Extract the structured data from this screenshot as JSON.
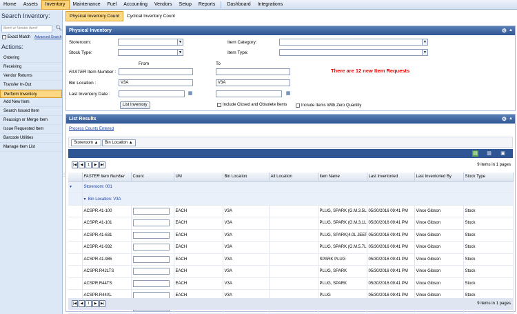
{
  "menu": [
    "Home",
    "Assets",
    "Inventory",
    "Maintenance",
    "Fuel",
    "Accounting",
    "Vendors",
    "Setup",
    "Reports",
    "Dashboard",
    "Integrations"
  ],
  "menu_active": "Inventory",
  "submenu": [
    "Physical Inventory Count",
    "Cyclical Inventory Count"
  ],
  "sidebar": {
    "search_title": "Search Inventory:",
    "search_placeholder": "Item# or Vendor Item#",
    "exact_match": "Exact Match",
    "advanced_search": "Advanced Search",
    "actions_title": "Actions:",
    "actions": [
      "Ordering",
      "Receiving",
      "Vendor Returns",
      "Transfer In-Out",
      "Perform Inventory",
      "Add New Item",
      "Search Issued Item",
      "Reassign or Merge Item",
      "Issue Requested Item",
      "Barcode Utilities",
      "Manage Item List"
    ],
    "active_action": "Perform Inventory"
  },
  "physical_inventory": {
    "title": "Physical Inventory",
    "storeroom_label": "Storeroom:",
    "stock_type_label": "Stock Type:",
    "item_category_label": "Item Category:",
    "item_type_label": "Item Type:",
    "from_label": "From",
    "to_label": "To",
    "item_number_label_prefix": "FASTER",
    "item_number_label_suffix": "Item Number :",
    "bin_location_label": "Bin Location :",
    "bin_from": "V3A",
    "bin_to": "V3A",
    "last_inventory_date_label": "Last Inventory Date :",
    "list_button": "List Inventory",
    "include_closed": "Include Closed and Obsolete Items",
    "include_zero": "Include Items With Zero Quantity",
    "alert": "There are 12 new Item Requests"
  },
  "list_results": {
    "title": "List Results",
    "process_link": "Process Counts Entered",
    "group_chips": [
      "Storeroom",
      "Bin Location"
    ],
    "page": "1",
    "count_text": "9 items in 1 pages",
    "columns": [
      "FASTER Item Number",
      "Count",
      "UM",
      "Bin Location",
      "Alt Location",
      "Item Name",
      "Last Inventoried",
      "Last Inventoried By",
      "Stock Type"
    ],
    "group_storeroom": "Storeroom: 001",
    "group_bin": "Bin Location: V3A",
    "rows": [
      {
        "num": "ACSPR.41-100",
        "um": "EACH",
        "bin": "V3A",
        "alt": "",
        "name": "PLUG, SPARK (G.M.3.5L",
        "date": "05/30/2016 09:41 PM",
        "by": "Vince Gibson",
        "stock": "Stock"
      },
      {
        "num": "ACSPR.41-101",
        "um": "EACH",
        "bin": "V3A",
        "alt": "",
        "name": "PLUG, SPARK (G.M.3.1L",
        "date": "05/30/2016 09:41 PM",
        "by": "Vince Gibson",
        "stock": "Stock"
      },
      {
        "num": "ACSPR.41-631",
        "um": "EACH",
        "bin": "V3A",
        "alt": "",
        "name": "PLUG, SPARK(4.0L JEEP",
        "date": "05/30/2016 09:41 PM",
        "by": "Vince Gibson",
        "stock": "Stock"
      },
      {
        "num": "ACSPR.41-932",
        "um": "EACH",
        "bin": "V3A",
        "alt": "",
        "name": "PLUG, SPARK (G.M.5.7L",
        "date": "05/30/2016 09:41 PM",
        "by": "Vince Gibson",
        "stock": "Stock"
      },
      {
        "num": "ACSPR.41-985",
        "um": "EACH",
        "bin": "V3A",
        "alt": "",
        "name": "SPARK PLUG",
        "date": "05/30/2016 09:41 PM",
        "by": "Vince Gibson",
        "stock": "Stock"
      },
      {
        "num": "ACSPR.R42LTS",
        "um": "EACH",
        "bin": "V3A",
        "alt": "",
        "name": "PLUG, SPARK",
        "date": "05/30/2016 09:41 PM",
        "by": "Vince Gibson",
        "stock": "Stock"
      },
      {
        "num": "ACSPR.R44TS",
        "um": "EACH",
        "bin": "V3A",
        "alt": "",
        "name": "PLUG, SPARK",
        "date": "05/30/2016 09:41 PM",
        "by": "Vince Gibson",
        "stock": "Stock"
      },
      {
        "num": "ACSPR.R44XL",
        "um": "EACH",
        "bin": "V3A",
        "alt": "",
        "name": "PLUG",
        "date": "05/30/2016 09:41 PM",
        "by": "Vince Gibson",
        "stock": "Stock"
      },
      {
        "num": "ACSPR.R44XLS",
        "um": "EACH",
        "bin": "V3A",
        "alt": "",
        "name": "PLUG, SPARK (CSHMN)",
        "date": "05/30/2016 09:41 PM",
        "by": "Vince Gibson",
        "stock": "Stock"
      }
    ]
  },
  "colors": {
    "header_blue": "#2f5694",
    "active_orange": "#fcd784",
    "alert_red": "#ee0000"
  }
}
